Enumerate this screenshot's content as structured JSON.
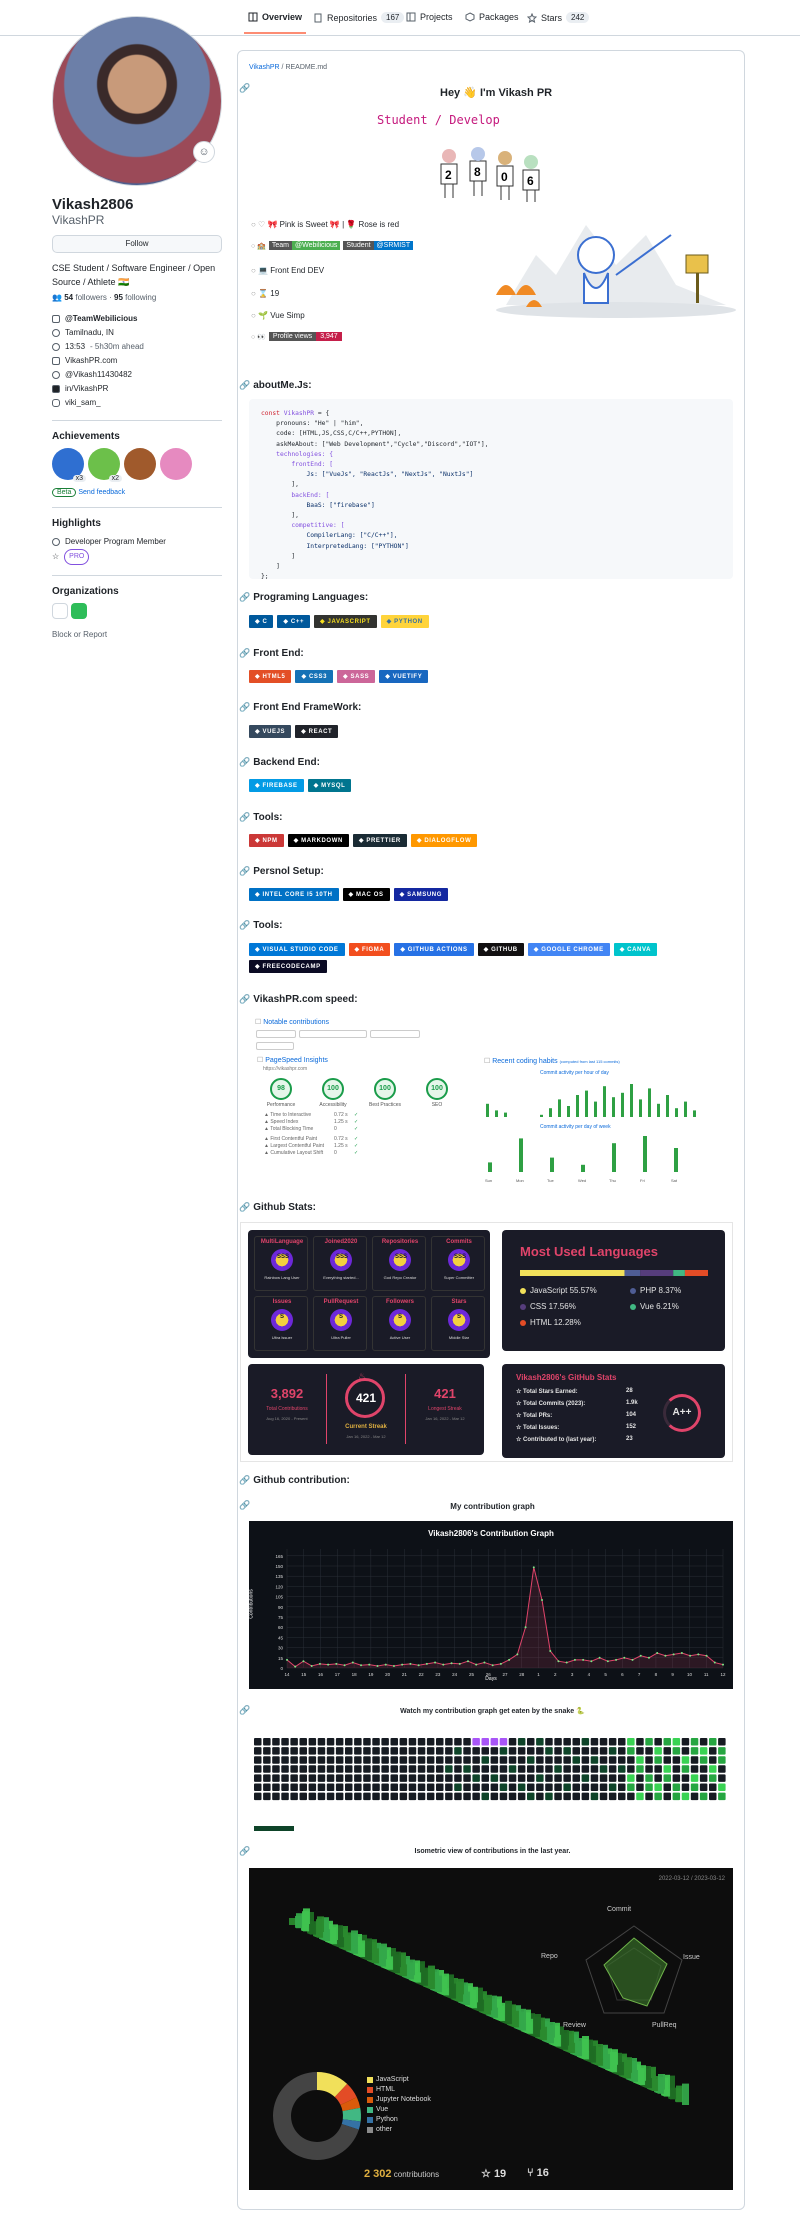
{
  "tabs": [
    {
      "label": "Overview",
      "count": ""
    },
    {
      "label": "Repositories",
      "count": "167"
    },
    {
      "label": "Projects",
      "count": ""
    },
    {
      "label": "Packages",
      "count": ""
    },
    {
      "label": "Stars",
      "count": "242"
    }
  ],
  "profile": {
    "name": "Vikash2806",
    "login": "VikashPR",
    "follow_label": "Follow",
    "bio": "CSE Student / Software Engineer / Open Source / Athlete 🇮🇳",
    "followers": "54",
    "followers_label": "followers",
    "following": "95",
    "following_label": "following",
    "org": "@TeamWebilicious",
    "location": "Tamilnadu, IN",
    "time": "13:53",
    "time_note": "- 5h30m ahead",
    "website": "VikashPR.com",
    "twitter": "@Vikash11430482",
    "linkedin": "in/VikashPR",
    "instagram": "viki_sam_"
  },
  "achievements": {
    "title": "Achievements",
    "badges": [
      {
        "name": "pull-shark",
        "count": "x3",
        "color": "#2f6fd1"
      },
      {
        "name": "yolo",
        "count": "x2",
        "color": "#6cc04a"
      },
      {
        "name": "pair-extraordinaire",
        "count": "",
        "color": "#a05a2c"
      },
      {
        "name": "quickdraw",
        "count": "",
        "color": "#e68ac0"
      }
    ],
    "beta_label": "Beta",
    "feedback_label": "Send feedback"
  },
  "highlights": {
    "title": "Highlights",
    "item": "Developer Program Member",
    "pro_label": "PRO"
  },
  "organizations": {
    "title": "Organizations",
    "block_label": "Block or Report"
  },
  "readme": {
    "breadcrumb_user": "VikashPR",
    "breadcrumb_file": "README.md",
    "greeting": "Hey 👋 I'm Vikash PR",
    "typing": "Student / Develop",
    "facts": [
      "Pink is Sweet 🎀 | 🌹 Rose is red",
      "",
      "Front End DEV",
      "19",
      "Vue Simp",
      ""
    ],
    "team_badges": [
      {
        "left": "Team",
        "right": "@Webilicious",
        "color": "#4caf50"
      },
      {
        "left": "Student",
        "right": "@SRMIST",
        "color": "#0075ca"
      }
    ],
    "profile_views_label": "Profile views",
    "profile_views": "3,947"
  },
  "sections": {
    "about": "aboutMe.Js:",
    "languages": "Programing Languages:",
    "frontend": "Front End:",
    "framework": "Front End FrameWork:",
    "backend": "Backend End:",
    "tools": "Tools:",
    "setup": "Persnol Setup:",
    "tools2": "Tools:",
    "speed": "VikashPR.com speed:",
    "stats": "Github Stats:",
    "contribution": "Github contribution:"
  },
  "code_lines": [
    "const VikashPR = {",
    "    pronouns: \"He\" | \"him\",",
    "    code: [HTML,JS,CSS,C/C++,PYTHON],",
    "    askMeAbout: [\"Web Development\",\"Cycle\",\"Discord\",\"IOT\"],",
    "    technologies: {",
    "        frontEnd: [",
    "            Js: [\"VueJs\", \"ReactJs\", \"NextJs\", \"NuxtJs\"]",
    "        ],",
    "        backEnd: [",
    "            BaaS: [\"firebase\"]",
    "        ],",
    "        competitive: [",
    "            CompilerLang: [\"C/C++\"],",
    "            InterpretedLang: [\"PYTHON\"]",
    "        ]",
    "    ]",
    "};"
  ],
  "badges": {
    "languages": [
      {
        "label": "C",
        "color": "#00599c"
      },
      {
        "label": "C++",
        "color": "#00599c"
      },
      {
        "label": "JAVASCRIPT",
        "color": "#323330",
        "text": "#f7df1e"
      },
      {
        "label": "PYTHON",
        "color": "#ffd43b",
        "text": "#3670a0"
      }
    ],
    "frontend": [
      {
        "label": "HTML5",
        "color": "#e34f26"
      },
      {
        "label": "CSS3",
        "color": "#1572b6"
      },
      {
        "label": "SASS",
        "color": "#cc6699"
      },
      {
        "label": "VUETIFY",
        "color": "#1867c0"
      }
    ],
    "framework": [
      {
        "label": "VUEJS",
        "color": "#35495e"
      },
      {
        "label": "REACT",
        "color": "#20232a"
      }
    ],
    "backend": [
      {
        "label": "FIREBASE",
        "color": "#039be5"
      },
      {
        "label": "MYSQL",
        "color": "#00758f"
      }
    ],
    "tools": [
      {
        "label": "NPM",
        "color": "#cb3837"
      },
      {
        "label": "MARKDOWN",
        "color": "#000000"
      },
      {
        "label": "PRETTIER",
        "color": "#1a2b34"
      },
      {
        "label": "DIALOGFLOW",
        "color": "#ff9800"
      }
    ],
    "setup": [
      {
        "label": "INTEL CORE I5 10TH",
        "color": "#0071c5"
      },
      {
        "label": "MAC OS",
        "color": "#000000"
      },
      {
        "label": "SAMSUNG",
        "color": "#1428a0"
      }
    ],
    "tools2": [
      {
        "label": "VISUAL STUDIO CODE",
        "color": "#0078d7"
      },
      {
        "label": "FIGMA",
        "color": "#f24e1e"
      },
      {
        "label": "GITHUB ACTIONS",
        "color": "#2671e5"
      },
      {
        "label": "GITHUB",
        "color": "#121011"
      },
      {
        "label": "GOOGLE CHROME",
        "color": "#4285f4"
      },
      {
        "label": "CANVA",
        "color": "#00c4cc"
      },
      {
        "label": "FREECODECAMP",
        "color": "#0a0a23"
      }
    ]
  },
  "speed": {
    "notable": "Notable contributions",
    "pagespeed": "PageSpeed Insights",
    "url": "https://vikashpr.com",
    "scores": [
      {
        "label": "Performance",
        "value": "98"
      },
      {
        "label": "Accessibility",
        "value": "100"
      },
      {
        "label": "Best Practices",
        "value": "100"
      },
      {
        "label": "SEO",
        "value": "100"
      }
    ],
    "metrics": [
      {
        "label": "Time to Interactive",
        "value": "0.72 s"
      },
      {
        "label": "Speed Index",
        "value": "1.25 s"
      },
      {
        "label": "Total Blocking Time",
        "value": "0"
      },
      {
        "label": "First Contentful Paint",
        "value": "0.72 s"
      },
      {
        "label": "Largest Contentful Paint",
        "value": "1.25 s"
      },
      {
        "label": "Cumulative Layout Shift",
        "value": "0"
      }
    ],
    "habits": "Recent coding habits",
    "habits_note": "(computed from last 115 commits)",
    "hour_label": "Commit activity per hour of day",
    "week_label": "Commit activity per day of week",
    "days": [
      "Sun",
      "Mon",
      "Tue",
      "Wed",
      "Thu",
      "Fri",
      "Sat"
    ]
  },
  "trophies": [
    {
      "title": "MultiLanguage",
      "sub": "Rainbow Lang User",
      "rank": "SSS",
      "color": "#e0446a"
    },
    {
      "title": "Joined2020",
      "sub": "Everything started...",
      "rank": "SSS",
      "color": "#e0446a"
    },
    {
      "title": "Repositories",
      "sub": "God Repo Creator",
      "rank": "SSS",
      "color": "#e0446a"
    },
    {
      "title": "Commits",
      "sub": "Super Committer",
      "rank": "SSS",
      "color": "#e0446a"
    },
    {
      "title": "Issues",
      "sub": "Ultra Issuer",
      "rank": "S",
      "color": "#e0446a"
    },
    {
      "title": "PullRequest",
      "sub": "Ultra Puller",
      "rank": "S",
      "color": "#e0446a"
    },
    {
      "title": "Followers",
      "sub": "Active User",
      "rank": "S",
      "color": "#e0446a"
    },
    {
      "title": "Stars",
      "sub": "Middle Star",
      "rank": "S",
      "color": "#e0446a"
    }
  ],
  "languages_card": {
    "title": "Most Used Languages",
    "items": [
      {
        "name": "JavaScript",
        "pct": "55.57%",
        "color": "#f1e05a",
        "value": 55.57
      },
      {
        "name": "PHP",
        "pct": "8.37%",
        "color": "#4f5d95",
        "value": 8.37
      },
      {
        "name": "CSS",
        "pct": "17.56%",
        "color": "#563d7c",
        "value": 17.56
      },
      {
        "name": "Vue",
        "pct": "6.21%",
        "color": "#41b883",
        "value": 6.21
      },
      {
        "name": "HTML",
        "pct": "12.28%",
        "color": "#e34c26",
        "value": 12.28
      }
    ]
  },
  "streak": {
    "total": "3,892",
    "total_label": "Total Contributions",
    "total_range": "Aug 16, 2020 - Present",
    "current": "421",
    "current_label": "Current Streak",
    "current_range": "Jan 16, 2022 - Mar 12",
    "longest": "421",
    "longest_label": "Longest Streak",
    "longest_range": "Jan 16, 2022 - Mar 12"
  },
  "stats_card": {
    "title": "Vikash2806's GitHub Stats",
    "rows": [
      {
        "label": "Total Stars Earned:",
        "value": "28"
      },
      {
        "label": "Total Commits (2023):",
        "value": "1.9k"
      },
      {
        "label": "Total PRs:",
        "value": "104"
      },
      {
        "label": "Total Issues:",
        "value": "152"
      },
      {
        "label": "Contributed to (last year):",
        "value": "23"
      }
    ],
    "grade": "A++"
  },
  "graph": {
    "caption": "My contribution graph",
    "title": "Vikash2806's Contribution Graph",
    "xlabel": "Days",
    "ylabel": "Contributions"
  },
  "chart_data": {
    "type": "line",
    "title": "Vikash2806's Contribution Graph",
    "xlabel": "Days",
    "ylabel": "Contributions",
    "ylim": [
      0,
      175
    ],
    "yticks": [
      0,
      15,
      30,
      45,
      60,
      75,
      90,
      105,
      120,
      135,
      150,
      165
    ],
    "x": [
      "14",
      "14",
      "15",
      "15",
      "16",
      "16",
      "17",
      "17",
      "18",
      "18",
      "19",
      "19",
      "20",
      "20",
      "21",
      "21",
      "22",
      "22",
      "23",
      "23",
      "24",
      "24",
      "25",
      "25",
      "26",
      "26",
      "27",
      "27",
      "28",
      "28",
      "1",
      "1",
      "2",
      "2",
      "3",
      "3",
      "4",
      "4",
      "5",
      "5",
      "6",
      "6",
      "7",
      "7",
      "8",
      "8",
      "9",
      "9",
      "10",
      "10",
      "11",
      "11",
      "12",
      "12"
    ],
    "xticks": [
      "14",
      "15",
      "16",
      "17",
      "18",
      "19",
      "20",
      "21",
      "22",
      "23",
      "24",
      "25",
      "26",
      "27",
      "28",
      "1",
      "2",
      "3",
      "4",
      "5",
      "6",
      "7",
      "8",
      "9",
      "10",
      "11",
      "12"
    ],
    "values": [
      12,
      2,
      10,
      3,
      6,
      5,
      6,
      4,
      8,
      4,
      5,
      3,
      5,
      3,
      5,
      6,
      4,
      6,
      8,
      5,
      7,
      6,
      10,
      5,
      8,
      4,
      6,
      12,
      20,
      60,
      148,
      100,
      25,
      10,
      8,
      12,
      12,
      10,
      15,
      10,
      12,
      15,
      12,
      18,
      15,
      22,
      18,
      20,
      22,
      18,
      20,
      18,
      8,
      5
    ]
  },
  "snake": {
    "caption": "Watch my contribution graph get eaten by the snake 🐍"
  },
  "iso": {
    "caption": "Isometric view of contributions in the last year.",
    "range": "2022-03-12 / 2023-03-12",
    "radar_labels": [
      "Commit",
      "Issue",
      "PullReq",
      "Review",
      "Repo"
    ],
    "legend": [
      {
        "name": "JavaScript",
        "color": "#f1e05a"
      },
      {
        "name": "HTML",
        "color": "#e34c26"
      },
      {
        "name": "Jupyter Notebook",
        "color": "#da5b0b"
      },
      {
        "name": "Vue",
        "color": "#41b883"
      },
      {
        "name": "Python",
        "color": "#3572a5"
      },
      {
        "name": "other",
        "color": "#8b8b8b"
      }
    ],
    "contributions": "2 302",
    "contributions_label": "contributions",
    "stars": "19",
    "forks": "16"
  }
}
